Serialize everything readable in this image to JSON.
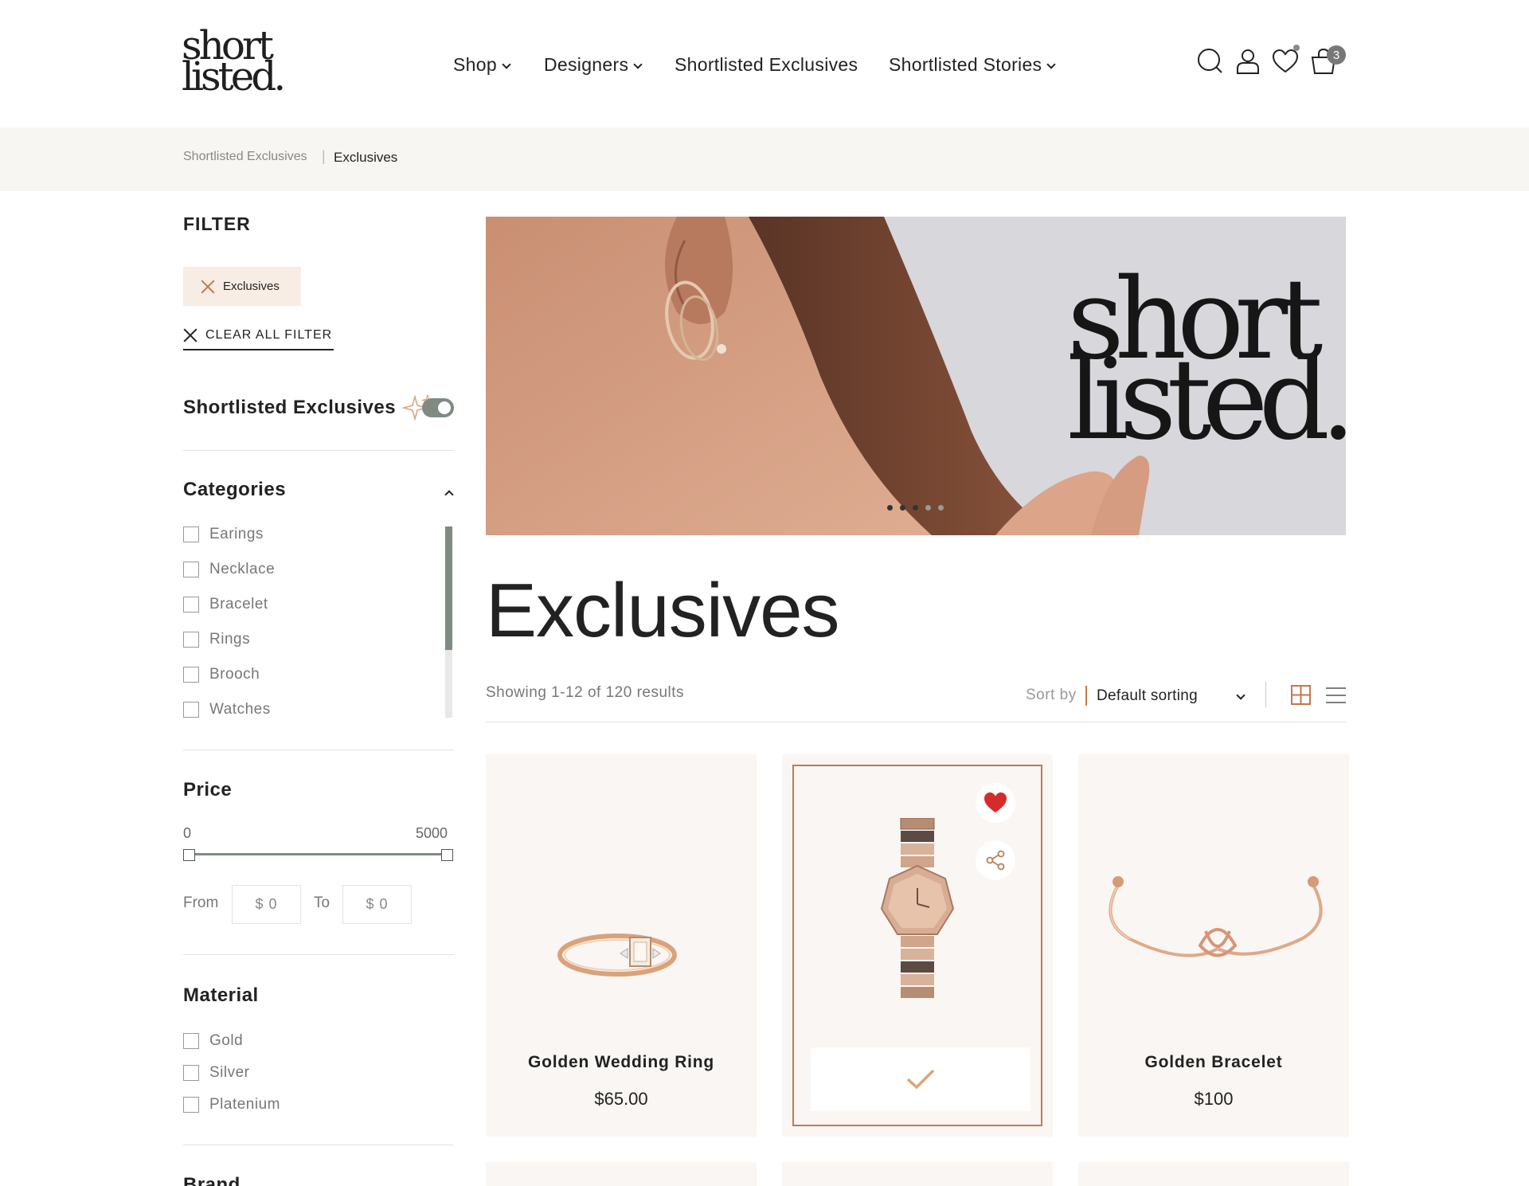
{
  "header": {
    "logo_line1": "short",
    "logo_line2": "listed.",
    "nav": [
      {
        "label": "Shop"
      },
      {
        "label": "Designers"
      },
      {
        "label": "Shortlisted Exclusives"
      },
      {
        "label": "Shortlisted Stories"
      }
    ],
    "cart_count": "3",
    "icons": [
      "search-icon",
      "user-icon",
      "wishlist-heart-icon",
      "cart-bag-icon"
    ]
  },
  "breadcrumb": {
    "parent": "Shortlisted Exclusives",
    "separator": "|",
    "current": "Exclusives"
  },
  "sidebar": {
    "filter_title": "FILTER",
    "active_chip": "Exclusives",
    "clear_all": "CLEAR ALL FILTER",
    "exclusives_toggle_label": "Shortlisted Exclusives",
    "exclusives_toggle_on": true,
    "categories": {
      "title": "Categories",
      "items": [
        "Earings",
        "Necklace",
        "Bracelet",
        "Rings",
        "Brooch",
        "Watches"
      ]
    },
    "price": {
      "title": "Price",
      "min": "0",
      "max": "5000",
      "from_label": "From",
      "to_label": "To",
      "from_value": "$ 0",
      "to_value": "$ 0"
    },
    "material": {
      "title": "Material",
      "items": [
        "Gold",
        "Silver",
        "Platenium"
      ]
    },
    "brand_title": "Brand"
  },
  "hero": {
    "logo_line1": "short",
    "logo_line2": "listed.",
    "slide_count": 5,
    "active_slide": 1
  },
  "main": {
    "title": "Exclusives",
    "results_text": "Showing 1-12 of 120 results",
    "sort_label": "Sort by",
    "sort_value": "Default sorting"
  },
  "products": [
    {
      "name": "Golden Wedding Ring",
      "price": "$65.00"
    },
    {
      "name": "",
      "price": "",
      "state": "hover-added",
      "wishlisted": true
    },
    {
      "name": "Golden Bracelet",
      "price": "$100"
    }
  ],
  "colors": {
    "accent": "#c07a4a",
    "toggle": "#7f8b80",
    "card_bg": "#f9f6f3",
    "wishlist_red": "#d62b2b"
  }
}
